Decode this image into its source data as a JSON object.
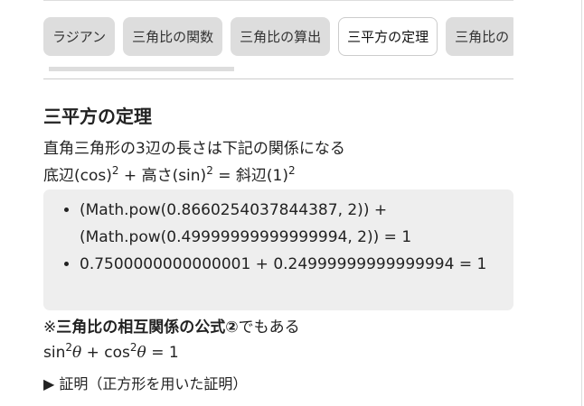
{
  "tabs": [
    "ラジアン",
    "三角比の関数",
    "三角比の算出",
    "三平方の定理",
    "三角比の"
  ],
  "active_tab": 3,
  "heading": "三平方の定理",
  "intro": "直角三角形の3辺の長さは下記の関係になる",
  "relation": {
    "a": "底辺(cos)",
    "b": " + 高さ(sin)",
    "c": " = 斜辺(1)",
    "exp": "2"
  },
  "list": [
    "(Math.pow(0.8660254037844387, 2)) + (Math.pow(0.49999999999999994, 2)) = 1",
    "0.7500000000000001 + 0.24999999999999994 = 1"
  ],
  "note": {
    "prefix": "※",
    "bold": "三角比の相互関係の公式②",
    "suffix": "でもある"
  },
  "formula": {
    "sin": "sin",
    "cos": " + cos",
    "theta": "θ",
    "eq": " = 1",
    "exp": "2"
  },
  "details": "▶ 証明（正方形を用いた証明）"
}
